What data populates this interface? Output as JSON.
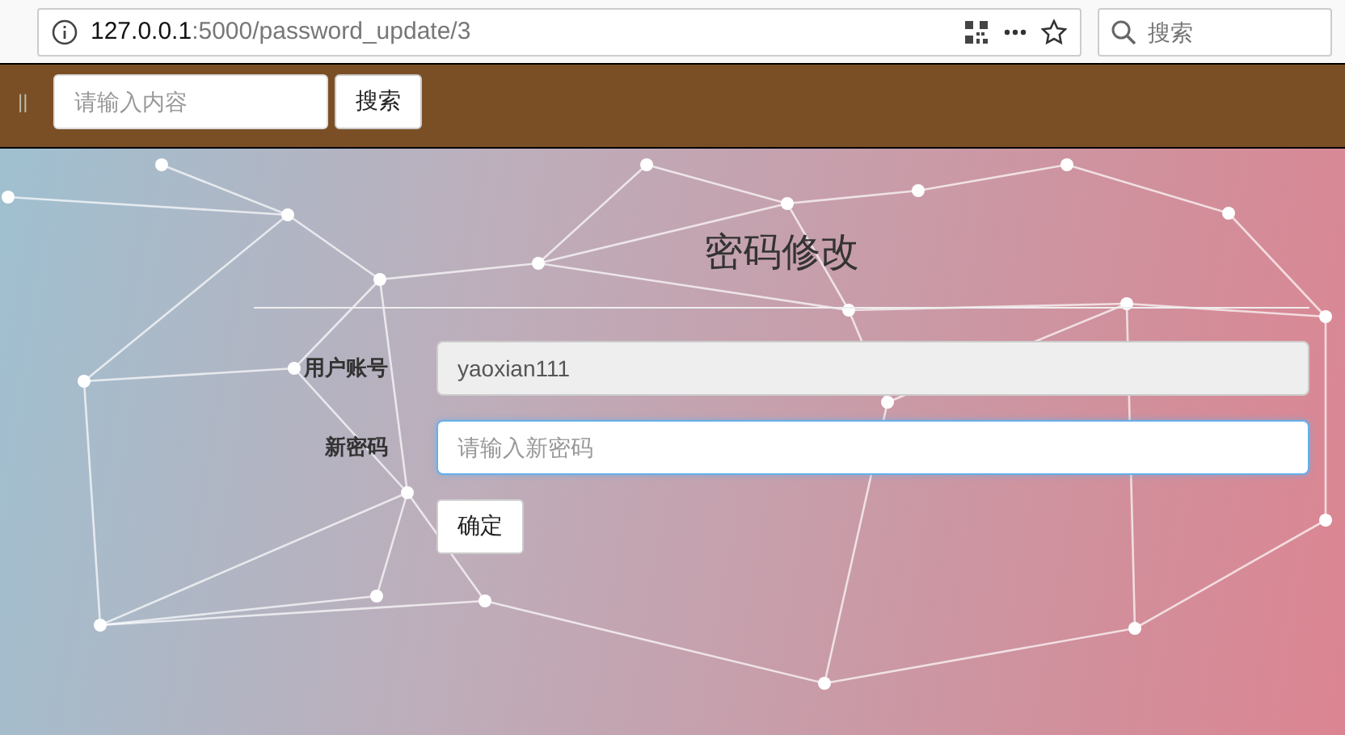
{
  "browser": {
    "url_host": "127.0.0.1",
    "url_path": ":5000/password_update/3",
    "search_placeholder": "搜索"
  },
  "toolbar": {
    "handle": "||",
    "search_placeholder": "请输入内容",
    "search_button": "搜索"
  },
  "form": {
    "title": "密码修改",
    "fields": [
      {
        "label": "用户账号",
        "value": "yaoxian111",
        "disabled": true,
        "focused": false
      },
      {
        "label": "新密码",
        "placeholder": "请输入新密码",
        "disabled": false,
        "focused": true
      }
    ],
    "submit": "确定"
  }
}
